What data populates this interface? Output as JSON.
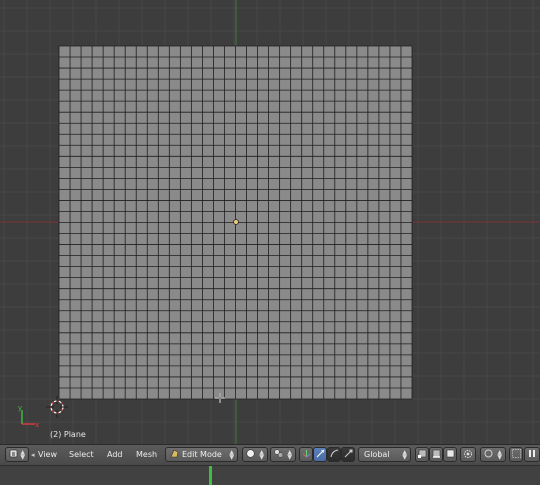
{
  "viewport": {
    "object_label": "(2) Plane",
    "grid_divisions": 32,
    "axis_colors": {
      "x": "#9a3a3a",
      "y": "#3f8a3f"
    },
    "mesh_face_color": "#8a8a8a",
    "mesh_edge_color": "#1e1e1e"
  },
  "header": {
    "editor_type_icon": "3d-view-icon",
    "menus": [
      {
        "label": "View"
      },
      {
        "label": "Select"
      },
      {
        "label": "Add"
      },
      {
        "label": "Mesh"
      }
    ],
    "mode_icon": "edit-mode-icon",
    "mode_value": "Edit Mode",
    "shading_icon": "solid-shading-icon",
    "pivot_icon": "pivot-icon",
    "transform_orientation": "Global",
    "select_mode_icons": [
      "vertex-select-icon",
      "edge-select-icon",
      "face-select-icon"
    ]
  },
  "colors": {
    "header_bg": "#4f4f4f",
    "viewport_bg": "#3d3d3d",
    "accent_blue": "#5d80b8"
  }
}
